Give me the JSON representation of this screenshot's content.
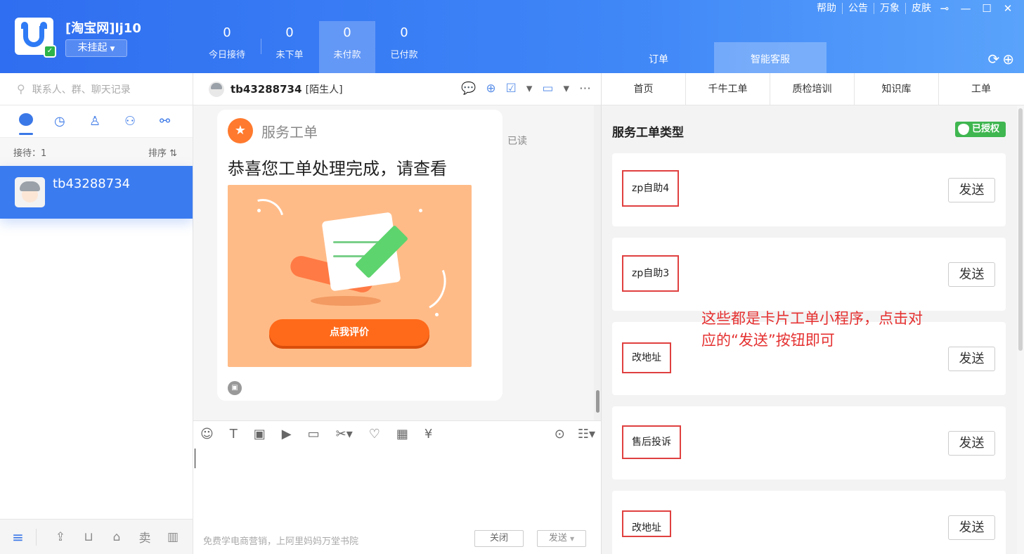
{
  "header": {
    "account_name": "[淘宝网]lj10",
    "status": "未挂起",
    "stats": [
      {
        "num": "0",
        "label": "今日接待"
      },
      {
        "num": "0",
        "label": "未下单"
      },
      {
        "num": "0",
        "label": "未付款"
      },
      {
        "num": "0",
        "label": "已付款"
      }
    ],
    "menu": [
      "帮助",
      "公告",
      "万象",
      "皮肤"
    ],
    "right_tabs": [
      "订单",
      "智能客服"
    ],
    "colors": {
      "brand_blue": "#2f6ef0",
      "accent_orange": "#ff6a1a",
      "annotation_red": "#e53030",
      "auth_green": "#3fb650"
    }
  },
  "left": {
    "search_placeholder": "联系人、群、聊天记录",
    "reception_label": "接待：1",
    "sort_label": "排序",
    "contact_name": "tb43288734",
    "bottom_sell_label": "卖"
  },
  "chat": {
    "contact_name": "tb43288734",
    "contact_tag": "[陌生人]",
    "read_status": "已读",
    "card": {
      "title": "服务工单",
      "text": "恭喜您工单处理完成，请查看",
      "button": "点我评价"
    },
    "ad_text": "免费学电商营销，上阿里妈妈万堂书院",
    "close_label": "关闭",
    "send_label": "发送"
  },
  "right": {
    "nav": [
      "首页",
      "千牛工单",
      "质检培训",
      "知识库",
      "工单"
    ],
    "title": "服务工单类型",
    "auth_badge": "已授权",
    "send_label": "发送",
    "tickets": [
      "zp自助4",
      "zp自助3",
      "改地址",
      "售后投诉",
      "改地址"
    ],
    "note": "这些都是卡片工单小程序，点击对应的“发送”按钮即可"
  }
}
